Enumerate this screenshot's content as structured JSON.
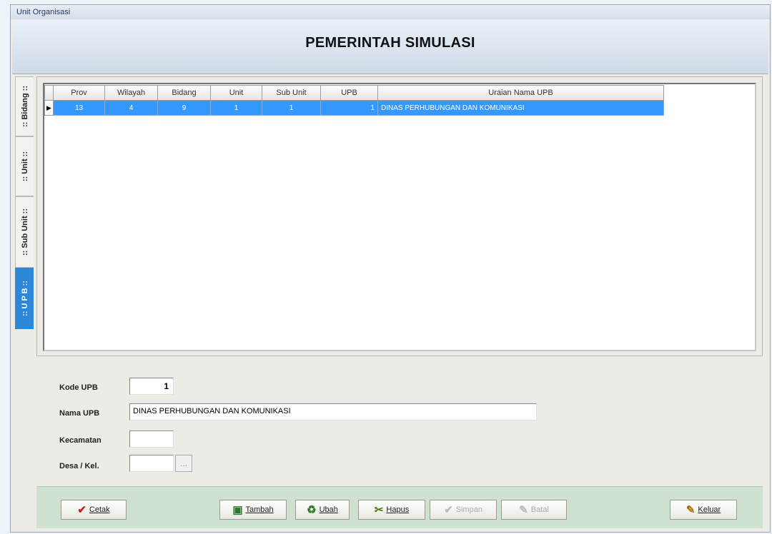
{
  "window": {
    "title": "Unit Organisasi"
  },
  "header": {
    "title": "PEMERINTAH SIMULASI"
  },
  "tabs": [
    {
      "label": ":: Bidang ::",
      "active": false
    },
    {
      "label": ":: Unit ::",
      "active": false
    },
    {
      "label": ":: Sub Unit ::",
      "active": false
    },
    {
      "label": ":: U P B ::",
      "active": true
    }
  ],
  "grid": {
    "columns": [
      "Prov",
      "Wilayah",
      "Bidang",
      "Unit",
      "Sub Unit",
      "UPB",
      "Uraian Nama UPB"
    ],
    "rows": [
      {
        "indicator": "▶",
        "prov": "13",
        "wilayah": "4",
        "bidang": "9",
        "unit": "1",
        "sub_unit": "1",
        "upb": "1",
        "uraian": "DINAS PERHUBUNGAN DAN KOMUNIKASI"
      }
    ]
  },
  "form": {
    "kode_label": "Kode UPB",
    "kode_value": "1",
    "nama_label": "Nama UPB",
    "nama_value": "DINAS PERHUBUNGAN DAN KOMUNIKASI",
    "kecamatan_label": "Kecamatan",
    "kecamatan_value": "",
    "desa_label": "Desa / Kel.",
    "desa_value": "",
    "desa_pick": "..."
  },
  "buttons": {
    "cetak": {
      "label": "Cetak",
      "icon": "✔",
      "color": "#d0201a"
    },
    "tambah": {
      "label": "Tambah",
      "icon": "▣",
      "color": "#2a7a2a"
    },
    "ubah": {
      "label": "Ubah",
      "icon": "♻",
      "color": "#2a7a2a"
    },
    "hapus": {
      "label": "Hapus",
      "icon": "✂",
      "color": "#4a7a10"
    },
    "simpan": {
      "label": "Simpan",
      "icon": "✔",
      "enabled": false
    },
    "batal": {
      "label": "Batal",
      "icon": "✎",
      "enabled": false
    },
    "keluar": {
      "label": "Keluar",
      "icon": "✎",
      "color": "#b07010"
    }
  }
}
